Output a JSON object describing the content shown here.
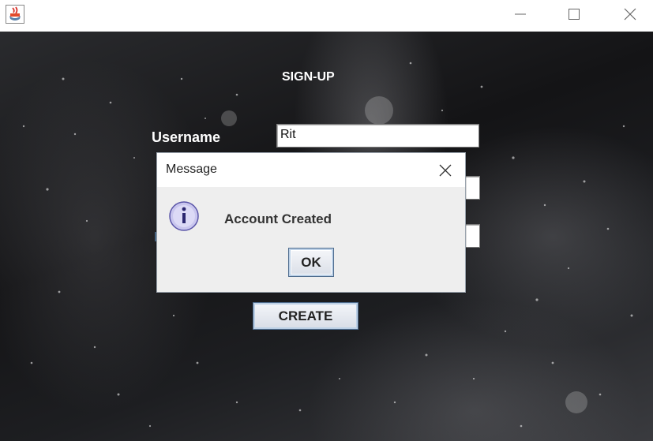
{
  "window": {
    "app_icon": "java-coffee-cup-icon",
    "controls": [
      "minimize-icon",
      "maximize-icon",
      "close-icon"
    ]
  },
  "form": {
    "heading": "SIGN-UP",
    "username_label": "Username",
    "username_value": "Rit",
    "create_label": "CREATE"
  },
  "dialog": {
    "title": "Message",
    "icon": "info-icon",
    "message": "Account Created",
    "ok_label": "OK"
  },
  "colors": {
    "dialog_bg": "#eeeeee",
    "button_border": "#4f6d8f",
    "info_icon_fill": "#c9c6ee"
  }
}
